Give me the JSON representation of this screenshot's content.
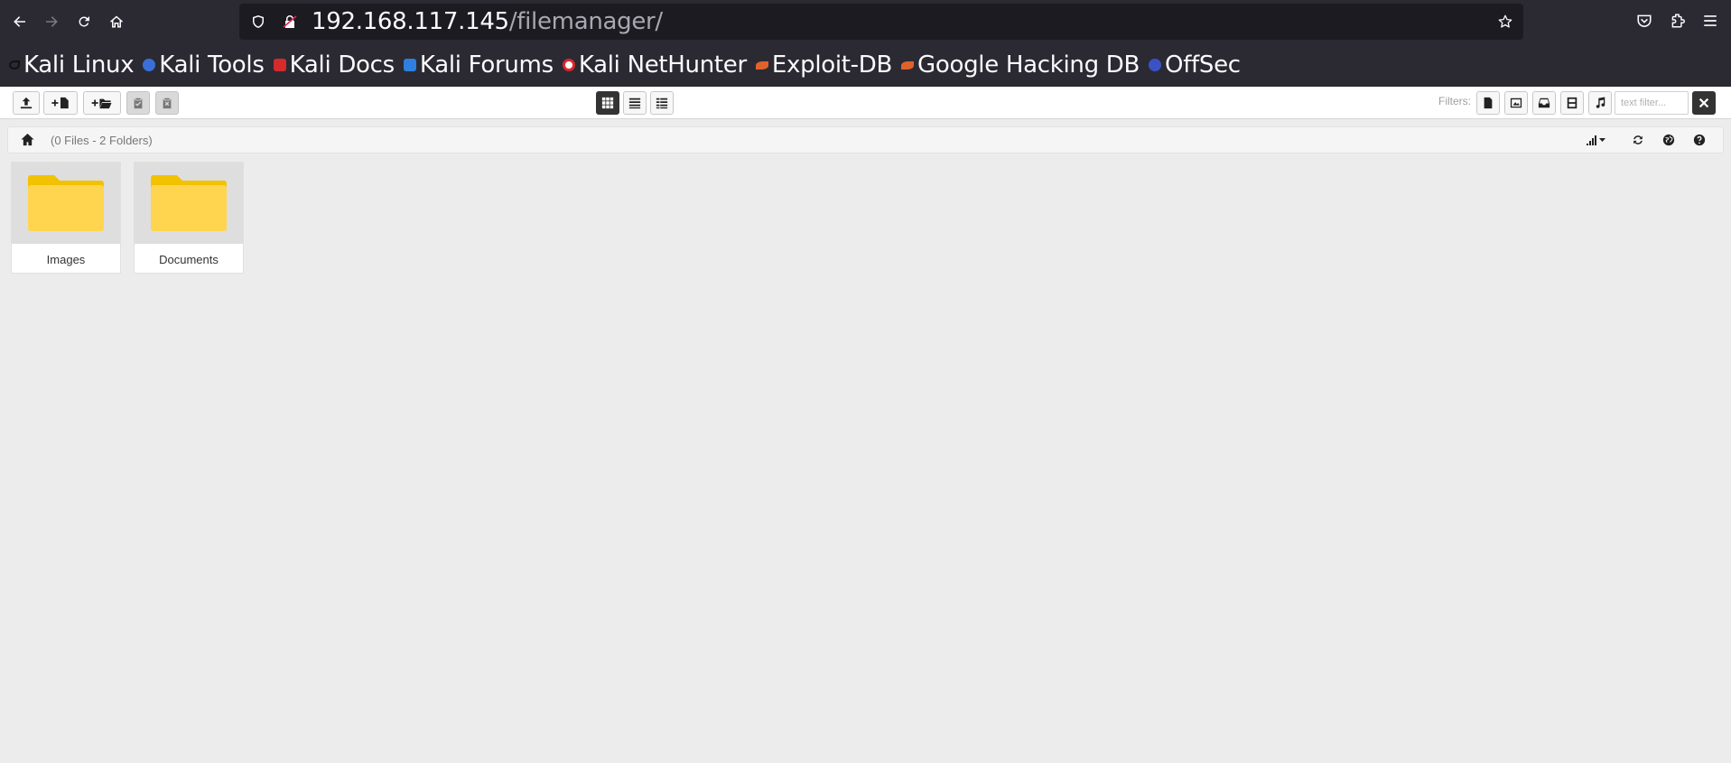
{
  "browser": {
    "url_host": "192.168.117.145",
    "url_path": "/filemanager/",
    "bookmarks": [
      {
        "label": "Kali Linux",
        "color": "#222222"
      },
      {
        "label": "Kali Tools",
        "color": "#3b6fd8"
      },
      {
        "label": "Kali Docs",
        "color": "#d62b2b"
      },
      {
        "label": "Kali Forums",
        "color": "#2f7fe0"
      },
      {
        "label": "Kali NetHunter",
        "color": "#d62b2b"
      },
      {
        "label": "Exploit-DB",
        "color": "#e0622b"
      },
      {
        "label": "Google Hacking DB",
        "color": "#e0622b"
      },
      {
        "label": "OffSec",
        "color": "#3b52c7"
      }
    ]
  },
  "toolbar": {
    "filters_label": "Filters:",
    "text_filter_placeholder": "text filter..."
  },
  "breadcrumb": {
    "info": "(0 Files - 2 Folders)"
  },
  "items": [
    {
      "name": "Images",
      "type": "folder"
    },
    {
      "name": "Documents",
      "type": "folder"
    }
  ],
  "colors": {
    "folder_back": "#f2c200",
    "folder_front": "#ffd54f",
    "active_view": "#333333"
  }
}
